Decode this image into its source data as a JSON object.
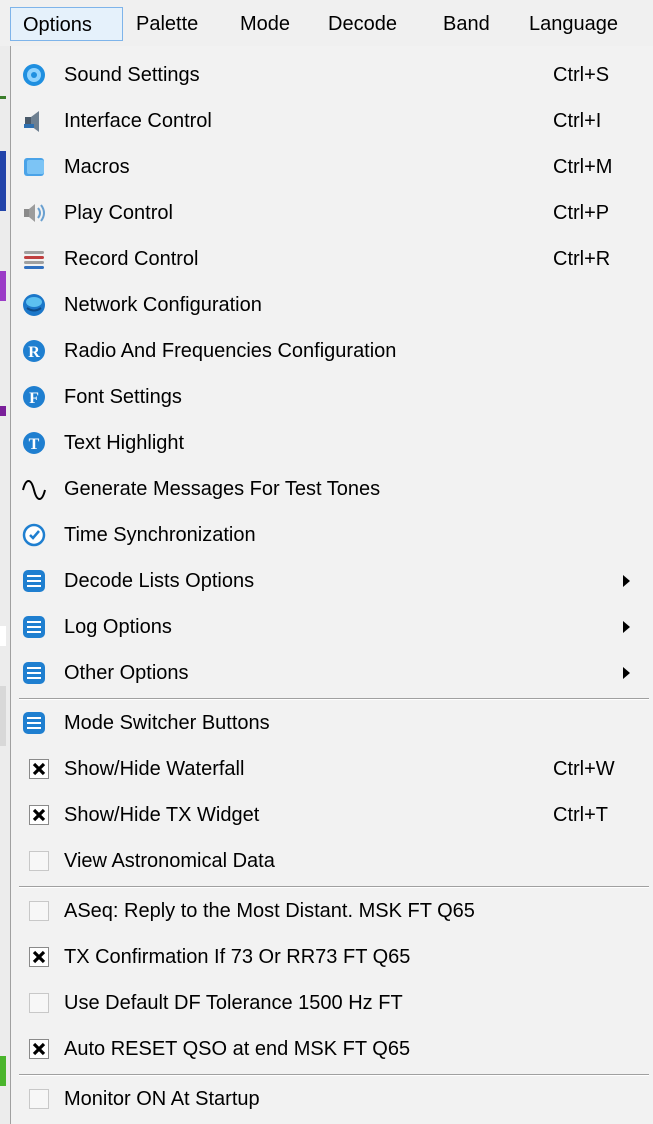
{
  "menubar": {
    "items": [
      "Options",
      "Palette",
      "Mode",
      "Decode",
      "Band",
      "Language"
    ],
    "active": "Options"
  },
  "menu": {
    "items": [
      {
        "label": "Sound Settings",
        "shortcut": "Ctrl+S",
        "icon": "gear-icon"
      },
      {
        "label": "Interface Control",
        "shortcut": "Ctrl+I",
        "icon": "speaker-tools-icon"
      },
      {
        "label": "Macros",
        "shortcut": "Ctrl+M",
        "icon": "scroll-icon"
      },
      {
        "label": "Play Control",
        "shortcut": "Ctrl+P",
        "icon": "speaker-icon"
      },
      {
        "label": "Record Control",
        "shortcut": "Ctrl+R",
        "icon": "cable-icon"
      },
      {
        "label": "Network Configuration",
        "shortcut": "",
        "icon": "globe-icon"
      },
      {
        "label": "Radio And Frequencies Configuration",
        "shortcut": "",
        "icon": "letter-r-icon"
      },
      {
        "label": "Font Settings",
        "shortcut": "",
        "icon": "letter-f-icon"
      },
      {
        "label": "Text Highlight",
        "shortcut": "",
        "icon": "letter-t-icon"
      },
      {
        "label": "Generate Messages For Test Tones",
        "shortcut": "",
        "icon": "sine-wave-icon"
      },
      {
        "label": "Time Synchronization",
        "shortcut": "",
        "icon": "clock-sync-icon"
      },
      {
        "label": "Decode Lists Options",
        "shortcut": "",
        "icon": "list-icon",
        "submenu": true
      },
      {
        "label": "Log Options",
        "shortcut": "",
        "icon": "list-icon",
        "submenu": true
      },
      {
        "label": "Other Options",
        "shortcut": "",
        "icon": "list-icon",
        "submenu": true
      },
      {
        "label": "Mode Switcher Buttons",
        "shortcut": "",
        "icon": "list-icon"
      }
    ],
    "checks": [
      {
        "label": "Show/Hide Waterfall",
        "shortcut": "Ctrl+W",
        "checked": true
      },
      {
        "label": "Show/Hide TX Widget",
        "shortcut": "Ctrl+T",
        "checked": true
      },
      {
        "label": "View Astronomical Data",
        "shortcut": "",
        "checked": false
      },
      {
        "label": "ASeq: Reply to the Most Distant. MSK FT Q65",
        "shortcut": "",
        "checked": false
      },
      {
        "label": "TX Confirmation If 73 Or RR73 FT Q65",
        "shortcut": "",
        "checked": true
      },
      {
        "label": "Use Default DF Tolerance 1500 Hz FT",
        "shortcut": "",
        "checked": false
      },
      {
        "label": "Auto RESET QSO at end MSK FT Q65",
        "shortcut": "",
        "checked": true
      },
      {
        "label": "Monitor ON At Startup",
        "shortcut": "",
        "checked": false
      }
    ]
  },
  "colors": {
    "accent_blue": "#1f8fe0",
    "highlight": "#e5f1fb"
  }
}
